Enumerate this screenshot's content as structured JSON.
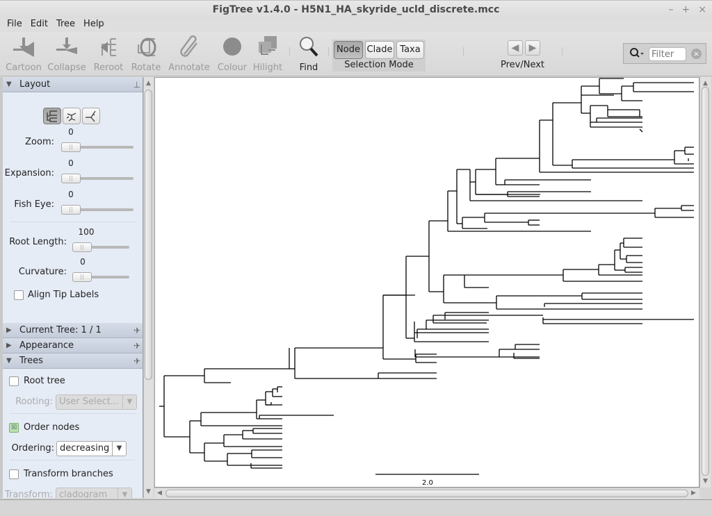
{
  "window": {
    "title": "FigTree v1.4.0 - H5N1_HA_skyride_ucld_discrete.mcc",
    "controls": [
      "–",
      "+",
      "×"
    ]
  },
  "menu": [
    "File",
    "Edit",
    "Tree",
    "Help"
  ],
  "toolbar": {
    "tools": [
      {
        "label": "Cartoon",
        "icon": "cartoon-icon",
        "enabled": false
      },
      {
        "label": "Collapse",
        "icon": "collapse-icon",
        "enabled": false
      },
      {
        "label": "Reroot",
        "icon": "reroot-icon",
        "enabled": false
      },
      {
        "label": "Rotate",
        "icon": "rotate-icon",
        "enabled": false
      },
      {
        "label": "Annotate",
        "icon": "paperclip-icon",
        "enabled": false
      },
      {
        "label": "Colour",
        "icon": "colour-circle-icon",
        "enabled": false
      },
      {
        "label": "Hilight",
        "icon": "hilight-icon",
        "enabled": false
      },
      {
        "label": "Find",
        "icon": "magnifier-icon",
        "enabled": true
      }
    ],
    "selection_mode": {
      "label": "Selection Mode",
      "options": [
        "Node",
        "Clade",
        "Taxa"
      ],
      "selected": "Node"
    },
    "prev_next": {
      "label": "Prev/Next"
    },
    "filter": {
      "placeholder": "Filter",
      "value": ""
    }
  },
  "sidebar": {
    "layout": {
      "title": "Layout",
      "expanded": true,
      "layout_types": [
        "rectangular",
        "polar",
        "radial"
      ],
      "selected_layout": "rectangular",
      "zoom": {
        "label": "Zoom:",
        "value": "0"
      },
      "expansion": {
        "label": "Expansion:",
        "value": "0"
      },
      "fish_eye": {
        "label": "Fish Eye:",
        "value": "0"
      },
      "root_length": {
        "label": "Root Length:",
        "value": "100"
      },
      "curvature": {
        "label": "Curvature:",
        "value": "0"
      },
      "align_tip_labels": {
        "label": "Align Tip Labels",
        "checked": false
      }
    },
    "current_tree": {
      "title": "Current Tree: 1 / 1",
      "expanded": false
    },
    "appearance": {
      "title": "Appearance",
      "expanded": false
    },
    "trees": {
      "title": "Trees",
      "expanded": true,
      "root_tree": {
        "label": "Root tree",
        "checked": false
      },
      "rooting": {
        "label": "Rooting:",
        "value": "User Select...",
        "enabled": false
      },
      "order_nodes": {
        "label": "Order nodes",
        "checked": true
      },
      "ordering": {
        "label": "Ordering:",
        "value": "decreasing"
      },
      "transform_branches": {
        "label": "Transform branches",
        "checked": false
      },
      "transform": {
        "label": "Transform:",
        "value": "cladogram",
        "enabled": false
      }
    }
  },
  "canvas": {
    "scale_bar_label": "2.0"
  }
}
